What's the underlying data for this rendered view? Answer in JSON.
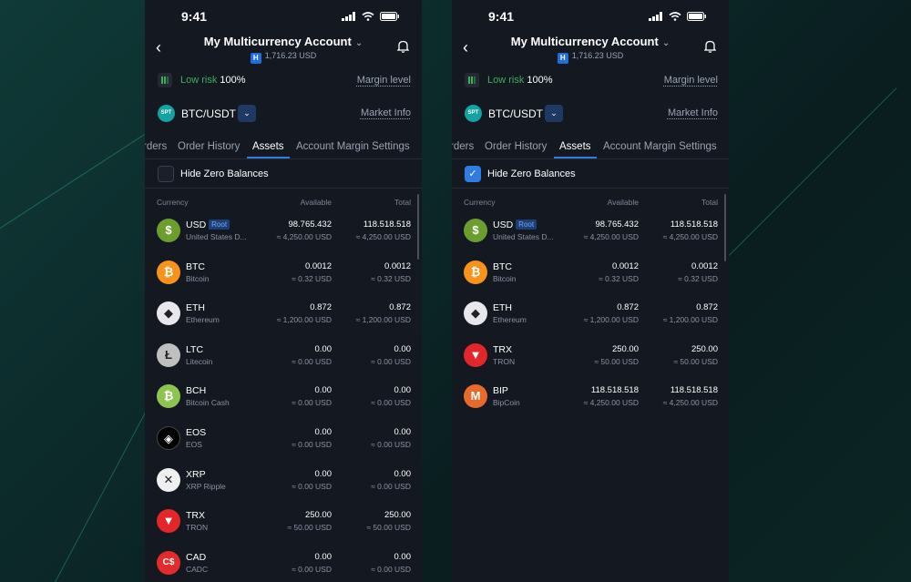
{
  "status": {
    "time": "9:41"
  },
  "header": {
    "title": "My Multicurrency Account",
    "badge": "H",
    "balance": "1,716.23 USD"
  },
  "risk": {
    "label": "Low risk",
    "value": "100%",
    "margin_link": "Margin level"
  },
  "pair": {
    "icon_text": "SPT",
    "label": "BTC/USDT",
    "market_link": "Market Info"
  },
  "tabs": [
    "rders",
    "Order History",
    "Assets",
    "Account Margin Settings"
  ],
  "hide_zero_label": "Hide Zero Balances",
  "columns": {
    "currency": "Currency",
    "available": "Available",
    "total": "Total"
  },
  "root_badge": "Root",
  "colors": {
    "accent": "#2f7de1",
    "risk_green": "#3fae5a",
    "background": "#141821"
  },
  "left": {
    "hide_zero_checked": false,
    "assets": [
      {
        "icon": "dollar-icon",
        "color": "#6b9e2f",
        "glyph": "$",
        "code": "USD",
        "root": true,
        "name": "United States D...",
        "available": "98.765.432",
        "available_fiat": "≈ 4,250.00 USD",
        "total": "118.518.518",
        "total_fiat": "≈ 4,250.00 USD"
      },
      {
        "icon": "bitcoin-icon",
        "color": "#f7931a",
        "glyph": "₿",
        "code": "BTC",
        "name": "Bitcoin",
        "available": "0.0012",
        "available_fiat": "≈ 0.32 USD",
        "total": "0.0012",
        "total_fiat": "≈ 0.32 USD"
      },
      {
        "icon": "ethereum-icon",
        "color": "#e8e8ec",
        "glyph": "◆",
        "code": "ETH",
        "name": "Ethereum",
        "available": "0.872",
        "available_fiat": "≈ 1,200.00 USD",
        "total": "0.872",
        "total_fiat": "≈ 1,200.00 USD"
      },
      {
        "icon": "litecoin-icon",
        "color": "#bfbfbf",
        "glyph": "Ł",
        "code": "LTC",
        "name": "Litecoin",
        "available": "0.00",
        "available_fiat": "≈ 0.00 USD",
        "total": "0.00",
        "total_fiat": "≈ 0.00 USD"
      },
      {
        "icon": "bitcoin-cash-icon",
        "color": "#8dc351",
        "glyph": "₿",
        "code": "BCH",
        "name": "Bitcoin Cash",
        "available": "0.00",
        "available_fiat": "≈ 0.00 USD",
        "total": "0.00",
        "total_fiat": "≈ 0.00 USD"
      },
      {
        "icon": "eos-icon",
        "color": "#000000",
        "glyph": "◈",
        "code": "EOS",
        "name": "EOS",
        "available": "0.00",
        "available_fiat": "≈ 0.00 USD",
        "total": "0.00",
        "total_fiat": "≈ 0.00 USD"
      },
      {
        "icon": "xrp-icon",
        "color": "#f0f0f0",
        "glyph": "✕",
        "code": "XRP",
        "name": "XRP Ripple",
        "available": "0.00",
        "available_fiat": "≈ 0.00 USD",
        "total": "0.00",
        "total_fiat": "≈ 0.00 USD"
      },
      {
        "icon": "tron-icon",
        "color": "#e3262a",
        "glyph": "▼",
        "code": "TRX",
        "name": "TRON",
        "available": "250.00",
        "available_fiat": "≈ 50.00 USD",
        "total": "250.00",
        "total_fiat": "≈ 50.00 USD"
      },
      {
        "icon": "cad-icon",
        "color": "#e32b2b",
        "glyph": "C$",
        "code": "CAD",
        "name": "CADC",
        "available": "0.00",
        "available_fiat": "≈ 0.00 USD",
        "total": "0.00",
        "total_fiat": "≈ 0.00 USD"
      }
    ]
  },
  "right": {
    "hide_zero_checked": true,
    "assets": [
      {
        "icon": "dollar-icon",
        "color": "#6b9e2f",
        "glyph": "$",
        "code": "USD",
        "root": true,
        "name": "United States D...",
        "available": "98.765.432",
        "available_fiat": "≈ 4,250.00 USD",
        "total": "118.518.518",
        "total_fiat": "≈ 4,250.00 USD"
      },
      {
        "icon": "bitcoin-icon",
        "color": "#f7931a",
        "glyph": "₿",
        "code": "BTC",
        "name": "Bitcoin",
        "available": "0.0012",
        "available_fiat": "≈ 0.32 USD",
        "total": "0.0012",
        "total_fiat": "≈ 0.32 USD"
      },
      {
        "icon": "ethereum-icon",
        "color": "#e8e8ec",
        "glyph": "◆",
        "code": "ETH",
        "name": "Ethereum",
        "available": "0.872",
        "available_fiat": "≈ 1,200.00 USD",
        "total": "0.872",
        "total_fiat": "≈ 1,200.00 USD"
      },
      {
        "icon": "tron-icon",
        "color": "#e3262a",
        "glyph": "▼",
        "code": "TRX",
        "name": "TRON",
        "available": "250.00",
        "available_fiat": "≈ 50.00 USD",
        "total": "250.00",
        "total_fiat": "≈ 50.00 USD"
      },
      {
        "icon": "bipcoin-icon",
        "color": "#e86a2a",
        "glyph": "M",
        "code": "BIP",
        "name": "BipCoin",
        "available": "118.518.518",
        "available_fiat": "≈ 4,250.00 USD",
        "total": "118.518.518",
        "total_fiat": "≈ 4,250.00 USD"
      }
    ]
  }
}
